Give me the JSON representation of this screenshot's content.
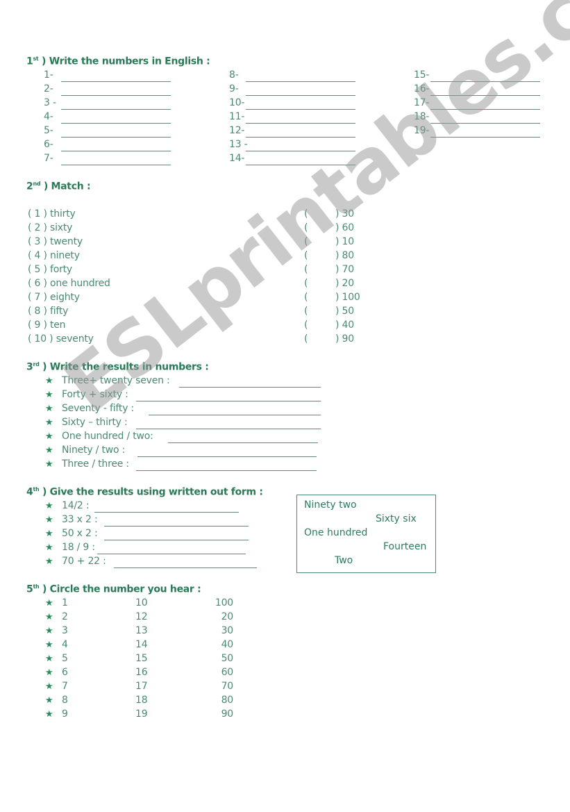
{
  "exercise1": {
    "number": "1",
    "suffix": "st",
    "title": ") Write the numbers in English :",
    "col1": [
      "1-",
      "2-",
      "3 -",
      "4-",
      "5-",
      "6-",
      "7-"
    ],
    "col2": [
      "8-",
      "9-",
      "10-",
      "11-",
      "12-",
      "13 -",
      "14-"
    ],
    "col3": [
      "15-",
      "16-",
      "17-",
      "18-",
      "19-"
    ]
  },
  "exercise2": {
    "number": "2",
    "suffix": "nd",
    "title": ") Match :",
    "left": [
      "( 1 ) thirty",
      "( 2 ) sixty",
      "( 3 ) twenty",
      "( 4 ) ninety",
      "( 5 ) forty",
      "( 6 ) one hundred",
      "( 7 ) eighty",
      "( 8 ) fifty",
      "( 9 ) ten",
      "( 10 ) seventy"
    ],
    "right_open": "(",
    "right": [
      ") 30",
      ") 60",
      ") 10",
      ") 80",
      ") 70",
      ") 20",
      ") 100",
      ") 50",
      ") 40",
      ") 90"
    ]
  },
  "exercise3": {
    "number": "3",
    "suffix": "rd",
    "title": ") Write the results in numbers :",
    "items": [
      "Three+ twenty seven :",
      "Forty + sixty :",
      "Seventy  -  fifty :",
      "Sixty – thirty :",
      "One hundred / two:",
      "Ninety / two :",
      "Three / three :"
    ]
  },
  "exercise4": {
    "number": "4",
    "suffix": "th",
    "title": ") Give the results using written out form :",
    "items": [
      "14/2 :",
      "33 x 2 :",
      "50 x 2 :",
      "18 / 9 :",
      "70 + 22 :"
    ],
    "word_box": [
      "Ninety two",
      "Sixty six",
      "One hundred",
      "Fourteen",
      "Two"
    ]
  },
  "exercise5": {
    "number": "5",
    "suffix": "th",
    "title": ") Circle the number you hear :",
    "rows": [
      [
        "1",
        "10",
        "100"
      ],
      [
        "2",
        "12",
        "20"
      ],
      [
        "3",
        "13",
        "30"
      ],
      [
        "4",
        "14",
        "40"
      ],
      [
        "5",
        "15",
        "50"
      ],
      [
        "6",
        "16",
        "60"
      ],
      [
        "7",
        "17",
        "70"
      ],
      [
        "8",
        "18",
        "80"
      ],
      [
        "9",
        "19",
        "90"
      ]
    ]
  },
  "bullet_icon": "star-icon",
  "watermark": "ESLprintables.com"
}
